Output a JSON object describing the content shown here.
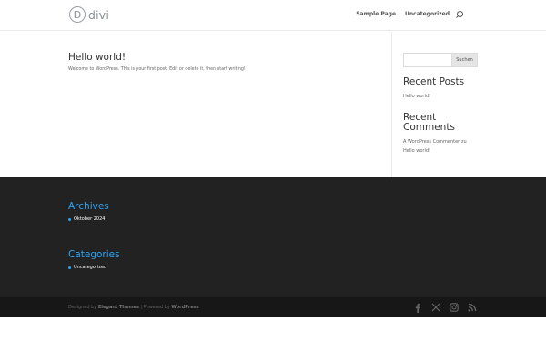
{
  "header": {
    "logo_letter": "D",
    "logo_text": "divi",
    "nav": [
      "Sample Page",
      "Uncategorized"
    ]
  },
  "post": {
    "title": "Hello world!",
    "excerpt": "Welcome to WordPress. This is your first post. Edit or delete it, then start writing!"
  },
  "sidebar": {
    "search_button": "Suchen",
    "recent_posts_title": "Recent Posts",
    "recent_posts": [
      "Hello world!"
    ],
    "recent_comments_title_line1": "Recent",
    "recent_comments_title_line2": "Comments",
    "comment_line1": "A WordPress Commenter zu",
    "comment_line2": "Hello world!"
  },
  "footer": {
    "archives_title": "Archives",
    "archives": [
      "Oktober 2024"
    ],
    "categories_title": "Categories",
    "categories": [
      "Uncategorized"
    ],
    "credits_prefix": "Designed by",
    "credits_theme": "Elegant Themes",
    "credits_separator": "| Powered by",
    "credits_wp": "WordPress"
  },
  "colors": {
    "accent": "#2ea3f2",
    "footer_bg": "#222222",
    "bottom_bar_bg": "#171717"
  }
}
